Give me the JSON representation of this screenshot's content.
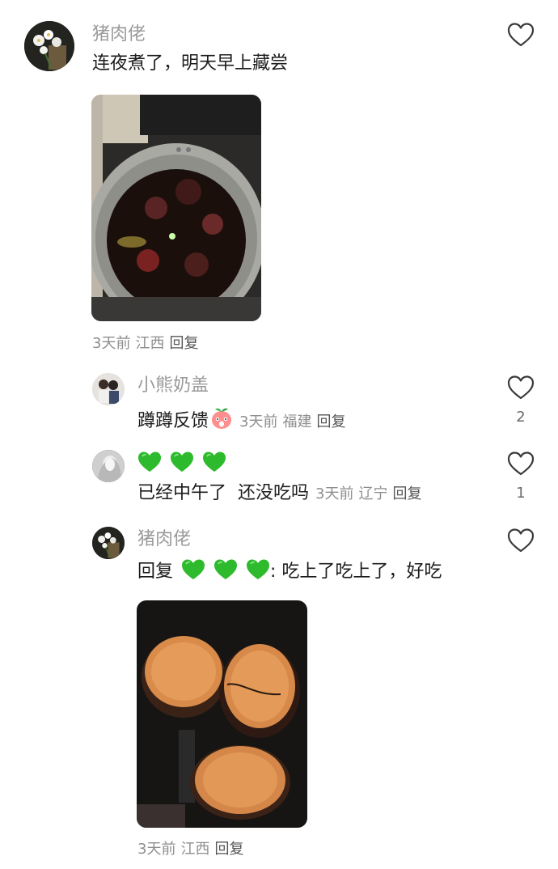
{
  "comments": [
    {
      "username": "猪肉佬",
      "text": "连夜煮了，明天早上藏尝",
      "meta": {
        "time": "3天前",
        "location": "江西",
        "reply": "回复"
      }
    }
  ],
  "replies": [
    {
      "username": "小熊奶盖",
      "text": "蹲蹲反馈",
      "emoji": "peach-face-emoji",
      "meta": {
        "time": "3天前",
        "location": "福建",
        "reply": "回复"
      },
      "likes": "2"
    },
    {
      "username": "",
      "name_emojis": [
        "green-heart-emoji",
        "green-heart-emoji",
        "green-heart-emoji"
      ],
      "text": "已经中午了  还没吃吗",
      "meta": {
        "time": "3天前",
        "location": "辽宁",
        "reply": "回复"
      },
      "likes": "1"
    },
    {
      "username": "猪肉佬",
      "reply_prefix": "回复",
      "reply_to_emojis": [
        "green-heart-emoji",
        "green-heart-emoji",
        "green-heart-emoji"
      ],
      "text": ": 吃上了吃上了，好吃",
      "meta": {
        "time": "3天前",
        "location": "江西",
        "reply": "回复"
      }
    }
  ],
  "icons": {
    "like": "heart-outline-icon",
    "emoji_heart_color": "#2dbb2d"
  }
}
